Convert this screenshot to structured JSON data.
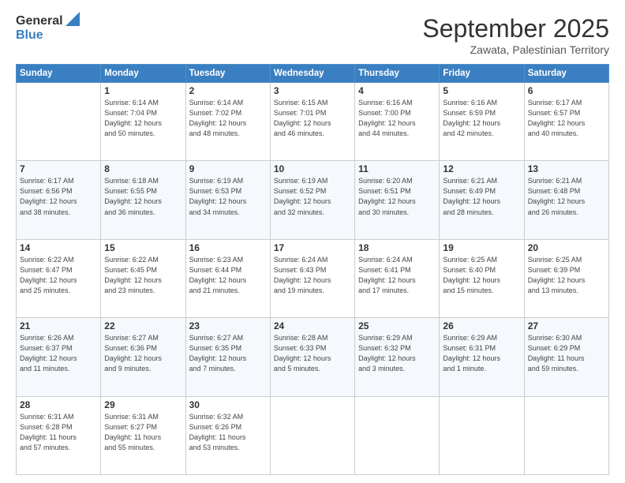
{
  "header": {
    "logo_general": "General",
    "logo_blue": "Blue",
    "title": "September 2025",
    "location": "Zawata, Palestinian Territory"
  },
  "days_of_week": [
    "Sunday",
    "Monday",
    "Tuesday",
    "Wednesday",
    "Thursday",
    "Friday",
    "Saturday"
  ],
  "weeks": [
    [
      {
        "day": "",
        "info": ""
      },
      {
        "day": "1",
        "info": "Sunrise: 6:14 AM\nSunset: 7:04 PM\nDaylight: 12 hours\nand 50 minutes."
      },
      {
        "day": "2",
        "info": "Sunrise: 6:14 AM\nSunset: 7:02 PM\nDaylight: 12 hours\nand 48 minutes."
      },
      {
        "day": "3",
        "info": "Sunrise: 6:15 AM\nSunset: 7:01 PM\nDaylight: 12 hours\nand 46 minutes."
      },
      {
        "day": "4",
        "info": "Sunrise: 6:16 AM\nSunset: 7:00 PM\nDaylight: 12 hours\nand 44 minutes."
      },
      {
        "day": "5",
        "info": "Sunrise: 6:16 AM\nSunset: 6:59 PM\nDaylight: 12 hours\nand 42 minutes."
      },
      {
        "day": "6",
        "info": "Sunrise: 6:17 AM\nSunset: 6:57 PM\nDaylight: 12 hours\nand 40 minutes."
      }
    ],
    [
      {
        "day": "7",
        "info": "Sunrise: 6:17 AM\nSunset: 6:56 PM\nDaylight: 12 hours\nand 38 minutes."
      },
      {
        "day": "8",
        "info": "Sunrise: 6:18 AM\nSunset: 6:55 PM\nDaylight: 12 hours\nand 36 minutes."
      },
      {
        "day": "9",
        "info": "Sunrise: 6:19 AM\nSunset: 6:53 PM\nDaylight: 12 hours\nand 34 minutes."
      },
      {
        "day": "10",
        "info": "Sunrise: 6:19 AM\nSunset: 6:52 PM\nDaylight: 12 hours\nand 32 minutes."
      },
      {
        "day": "11",
        "info": "Sunrise: 6:20 AM\nSunset: 6:51 PM\nDaylight: 12 hours\nand 30 minutes."
      },
      {
        "day": "12",
        "info": "Sunrise: 6:21 AM\nSunset: 6:49 PM\nDaylight: 12 hours\nand 28 minutes."
      },
      {
        "day": "13",
        "info": "Sunrise: 6:21 AM\nSunset: 6:48 PM\nDaylight: 12 hours\nand 26 minutes."
      }
    ],
    [
      {
        "day": "14",
        "info": "Sunrise: 6:22 AM\nSunset: 6:47 PM\nDaylight: 12 hours\nand 25 minutes."
      },
      {
        "day": "15",
        "info": "Sunrise: 6:22 AM\nSunset: 6:45 PM\nDaylight: 12 hours\nand 23 minutes."
      },
      {
        "day": "16",
        "info": "Sunrise: 6:23 AM\nSunset: 6:44 PM\nDaylight: 12 hours\nand 21 minutes."
      },
      {
        "day": "17",
        "info": "Sunrise: 6:24 AM\nSunset: 6:43 PM\nDaylight: 12 hours\nand 19 minutes."
      },
      {
        "day": "18",
        "info": "Sunrise: 6:24 AM\nSunset: 6:41 PM\nDaylight: 12 hours\nand 17 minutes."
      },
      {
        "day": "19",
        "info": "Sunrise: 6:25 AM\nSunset: 6:40 PM\nDaylight: 12 hours\nand 15 minutes."
      },
      {
        "day": "20",
        "info": "Sunrise: 6:25 AM\nSunset: 6:39 PM\nDaylight: 12 hours\nand 13 minutes."
      }
    ],
    [
      {
        "day": "21",
        "info": "Sunrise: 6:26 AM\nSunset: 6:37 PM\nDaylight: 12 hours\nand 11 minutes."
      },
      {
        "day": "22",
        "info": "Sunrise: 6:27 AM\nSunset: 6:36 PM\nDaylight: 12 hours\nand 9 minutes."
      },
      {
        "day": "23",
        "info": "Sunrise: 6:27 AM\nSunset: 6:35 PM\nDaylight: 12 hours\nand 7 minutes."
      },
      {
        "day": "24",
        "info": "Sunrise: 6:28 AM\nSunset: 6:33 PM\nDaylight: 12 hours\nand 5 minutes."
      },
      {
        "day": "25",
        "info": "Sunrise: 6:29 AM\nSunset: 6:32 PM\nDaylight: 12 hours\nand 3 minutes."
      },
      {
        "day": "26",
        "info": "Sunrise: 6:29 AM\nSunset: 6:31 PM\nDaylight: 12 hours\nand 1 minute."
      },
      {
        "day": "27",
        "info": "Sunrise: 6:30 AM\nSunset: 6:29 PM\nDaylight: 11 hours\nand 59 minutes."
      }
    ],
    [
      {
        "day": "28",
        "info": "Sunrise: 6:31 AM\nSunset: 6:28 PM\nDaylight: 11 hours\nand 57 minutes."
      },
      {
        "day": "29",
        "info": "Sunrise: 6:31 AM\nSunset: 6:27 PM\nDaylight: 11 hours\nand 55 minutes."
      },
      {
        "day": "30",
        "info": "Sunrise: 6:32 AM\nSunset: 6:26 PM\nDaylight: 11 hours\nand 53 minutes."
      },
      {
        "day": "",
        "info": ""
      },
      {
        "day": "",
        "info": ""
      },
      {
        "day": "",
        "info": ""
      },
      {
        "day": "",
        "info": ""
      }
    ]
  ]
}
